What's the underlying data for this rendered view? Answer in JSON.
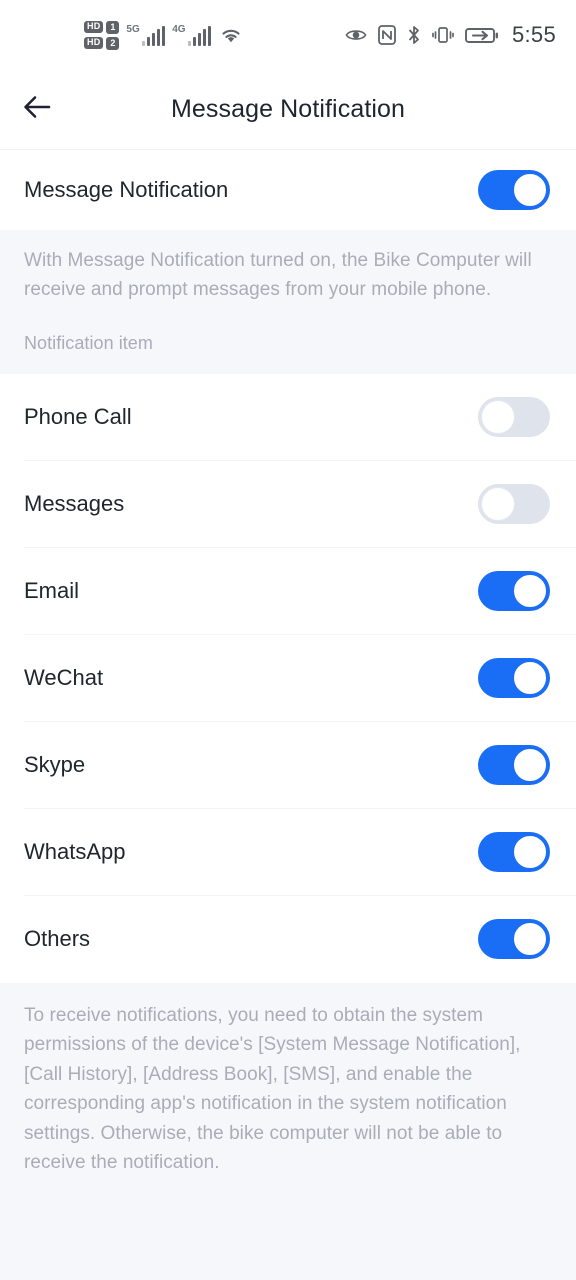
{
  "statusbar": {
    "hd_label_1": "HD",
    "sim_1": "1",
    "hd_label_2": "HD",
    "sim_2": "2",
    "network_1": "5G",
    "network_2": "4G",
    "icons": [
      "wifi-icon",
      "eye-icon",
      "nfc-icon",
      "bluetooth-icon",
      "vibrate-icon",
      "battery-charging-icon"
    ],
    "time": "5:55"
  },
  "header": {
    "back_icon": "arrow-left-icon",
    "title": "Message Notification"
  },
  "master": {
    "label": "Message Notification",
    "enabled": true,
    "state_text": "on"
  },
  "info": {
    "description": "With Message Notification turned on, the Bike Computer will receive and prompt messages from your mobile phone.",
    "section_label": "Notification item"
  },
  "items": [
    {
      "label": "Phone Call",
      "enabled": false
    },
    {
      "label": "Messages",
      "enabled": false
    },
    {
      "label": "Email",
      "enabled": true
    },
    {
      "label": "WeChat",
      "enabled": true
    },
    {
      "label": "Skype",
      "enabled": true
    },
    {
      "label": "WhatsApp",
      "enabled": true
    },
    {
      "label": "Others",
      "enabled": true
    }
  ],
  "footer": {
    "text": "To receive notifications, you need to obtain the system permissions of the device's [System Message Notification], [Call History], [Address Book], [SMS], and enable the corresponding app's notification in the system notification settings. Otherwise, the bike computer will not be able to receive the notification."
  },
  "colors": {
    "accent": "#1a6ef5",
    "toggle_off_track": "#dfe3ec",
    "panel_bg": "#f6f7fb",
    "card_bg": "#ffffff",
    "text_primary": "#21262e",
    "text_muted": "#a9adb8"
  }
}
